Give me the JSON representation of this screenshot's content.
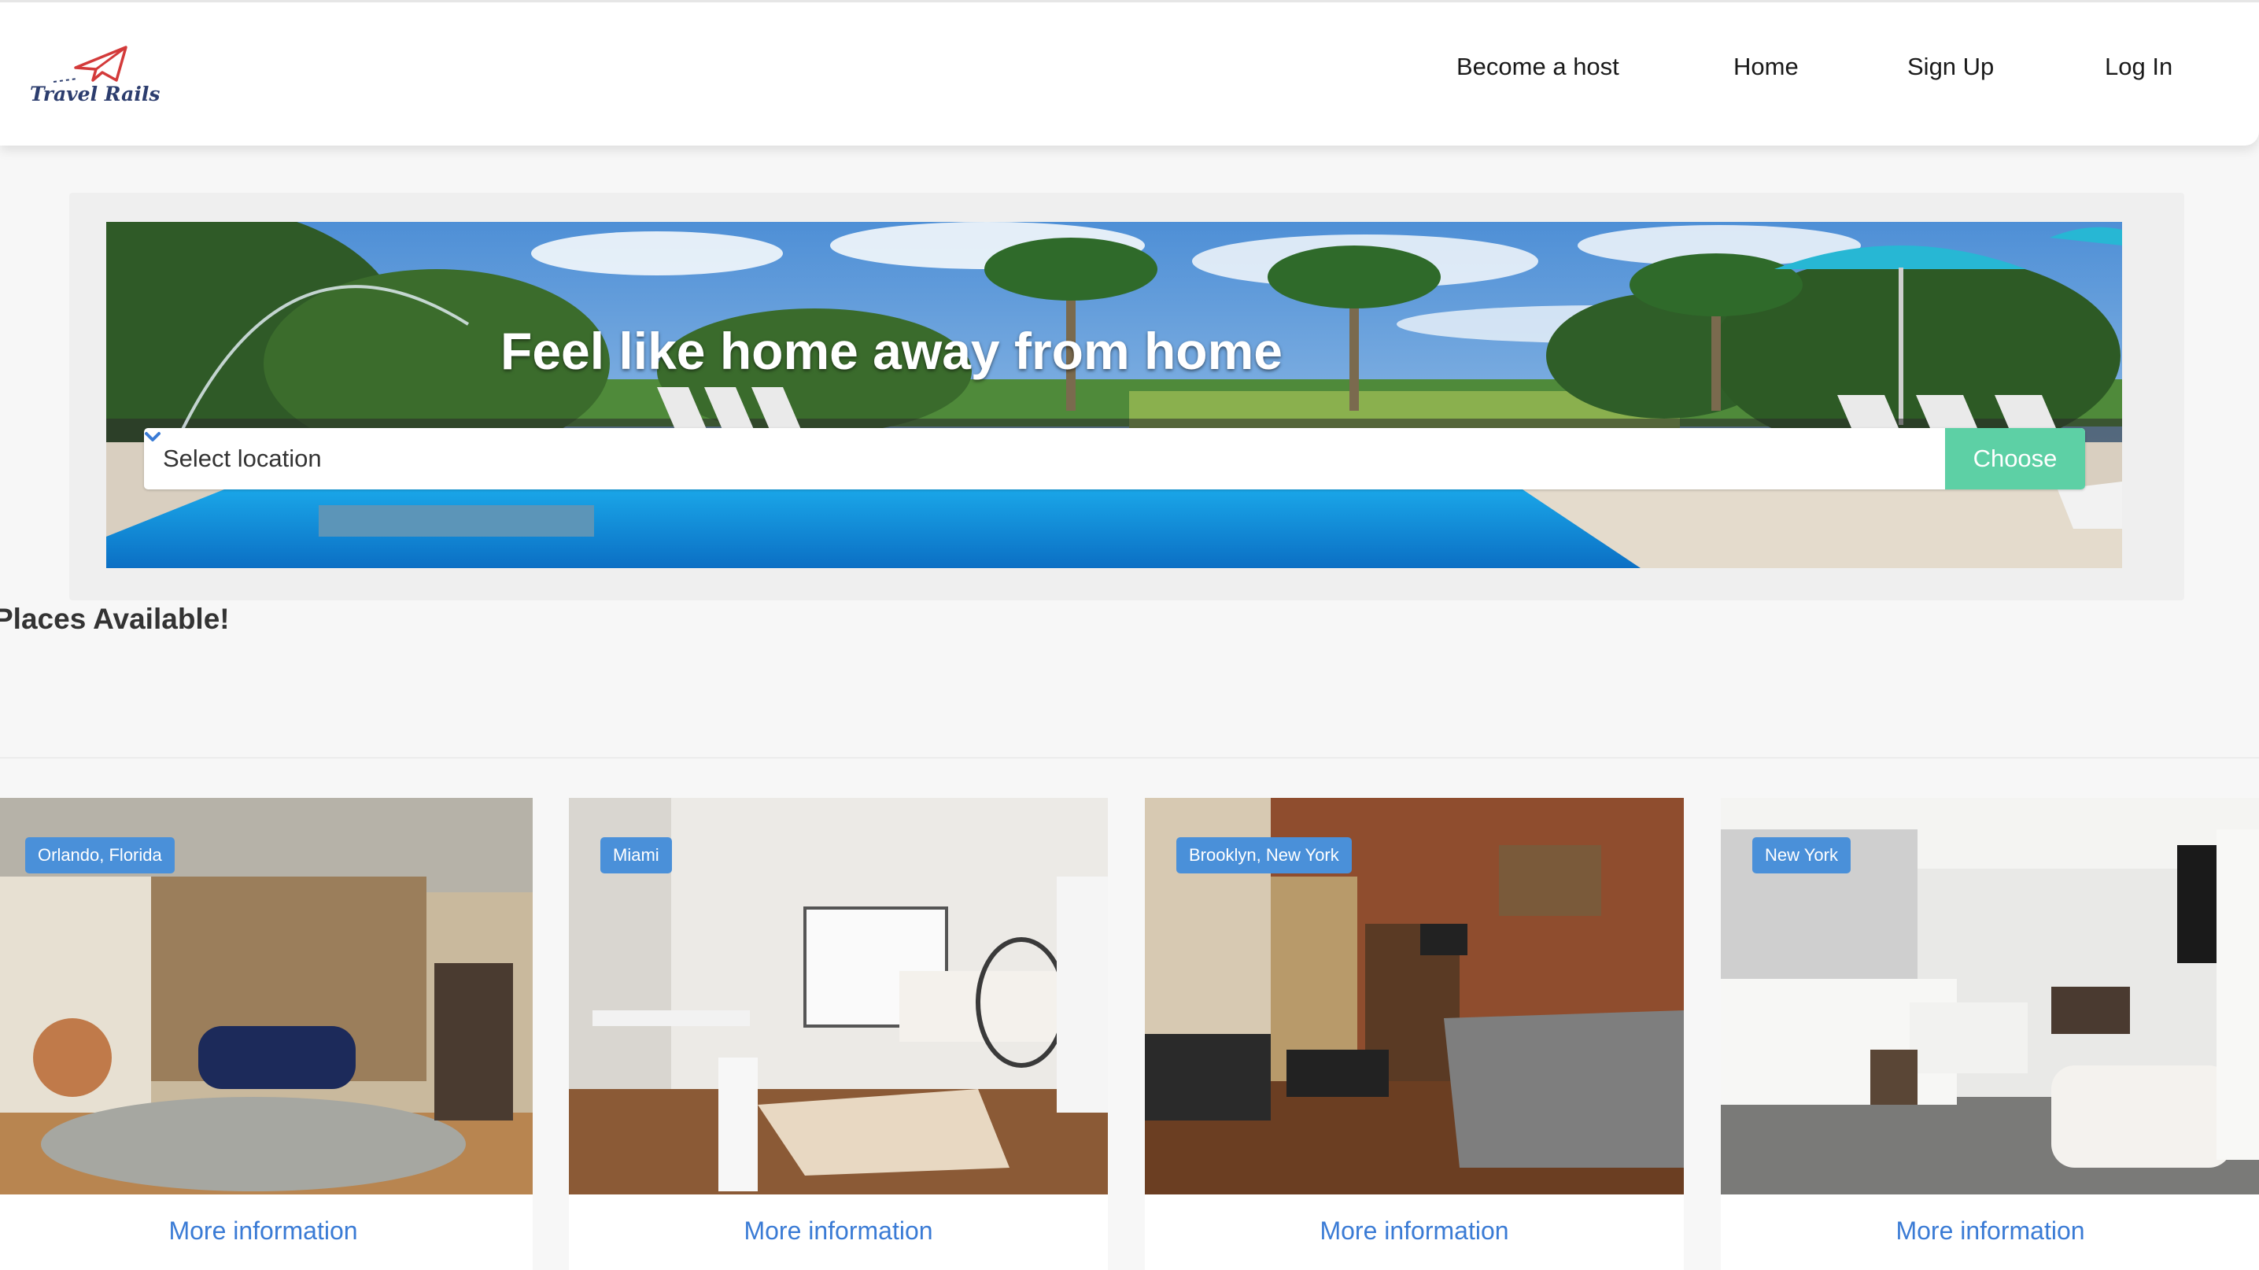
{
  "brand": {
    "logo_text": "Travel Rails",
    "logo_color": "#2c3d6e",
    "accent_color": "#d33a3a"
  },
  "nav": {
    "items": [
      {
        "label": "Become a host"
      },
      {
        "label": "Home"
      },
      {
        "label": "Sign Up"
      },
      {
        "label": "Log In"
      }
    ]
  },
  "hero": {
    "title": "Feel like home away from home",
    "select": {
      "value": "Select location",
      "icon": "chevron-down-icon"
    },
    "button_label": "Choose",
    "button_color": "#5dd0a5"
  },
  "section": {
    "title": "Places Available!"
  },
  "listings": [
    {
      "location": "Orlando, Florida",
      "link_label": "More information"
    },
    {
      "location": "Miami",
      "link_label": "More information"
    },
    {
      "location": "Brooklyn, New York",
      "link_label": "More information"
    },
    {
      "location": "New York",
      "link_label": "More information"
    }
  ],
  "colors": {
    "badge": "#4a90d9",
    "link": "#3a7bd5"
  }
}
